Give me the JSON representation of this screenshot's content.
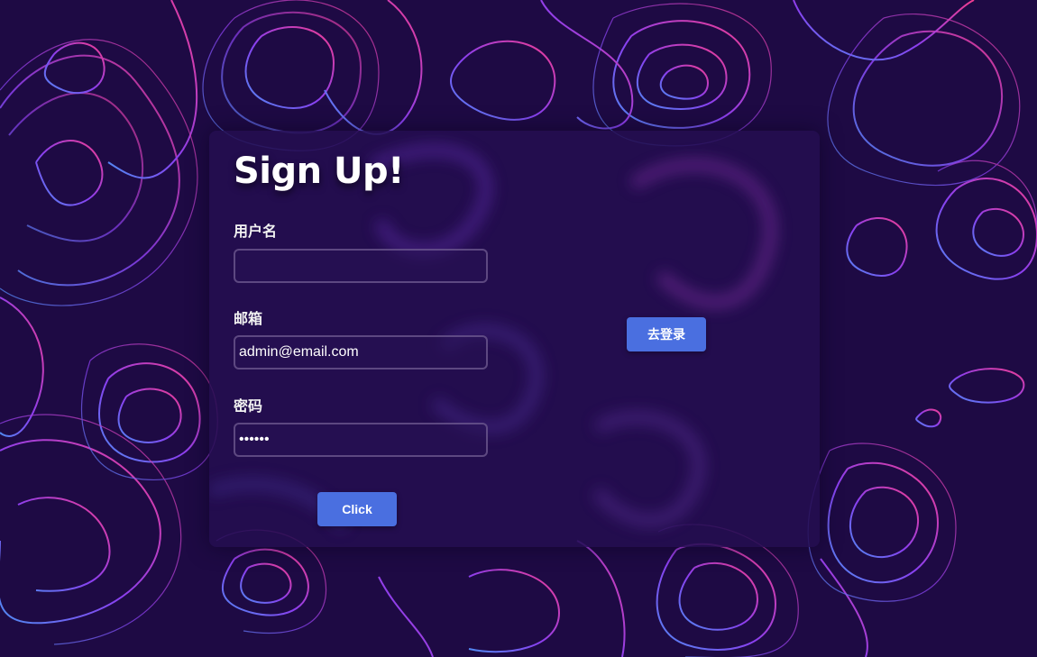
{
  "form": {
    "title": "Sign Up!",
    "username": {
      "label": "用户名",
      "value": "",
      "placeholder": ""
    },
    "email": {
      "label": "邮箱",
      "value": "admin@email.com"
    },
    "password": {
      "label": "密码",
      "value": "••••••"
    },
    "submit_label": "Click",
    "login_label": "去登录"
  },
  "colors": {
    "background": "#1e0a44",
    "card": "#240e50",
    "button": "#4a6fe0",
    "contour_blue": "#4f6cf2",
    "contour_purple": "#9b3bea",
    "contour_pink": "#ef3c9c"
  }
}
